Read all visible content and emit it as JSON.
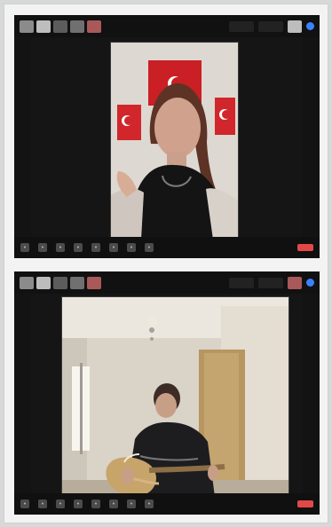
{
  "window": {
    "panel_count": 2
  },
  "panels": [
    {
      "thumbnail_count": 5,
      "top_controls": [
        "",
        ""
      ],
      "main_label": "",
      "participant_name": "",
      "bottom_control_count": 8,
      "scene_type": "woman-in-front-of-turkish-flags"
    },
    {
      "thumbnail_count": 5,
      "top_controls": [
        "",
        ""
      ],
      "main_label": "",
      "participant_name": "",
      "bottom_control_count": 8,
      "scene_type": "young-man-with-guitar-in-room"
    }
  ],
  "icons": {
    "flag": "flag-icon",
    "mic": "mic-icon",
    "video": "video-icon",
    "share": "share-icon",
    "participants": "participants-icon",
    "chat": "chat-icon",
    "record": "record-icon",
    "reactions": "reactions-icon",
    "leave": "leave-icon"
  },
  "colors": {
    "background": "#d7d9d9",
    "app_bg": "#151515",
    "accent_blue": "#3a83ff",
    "leave_red": "#e34848"
  }
}
